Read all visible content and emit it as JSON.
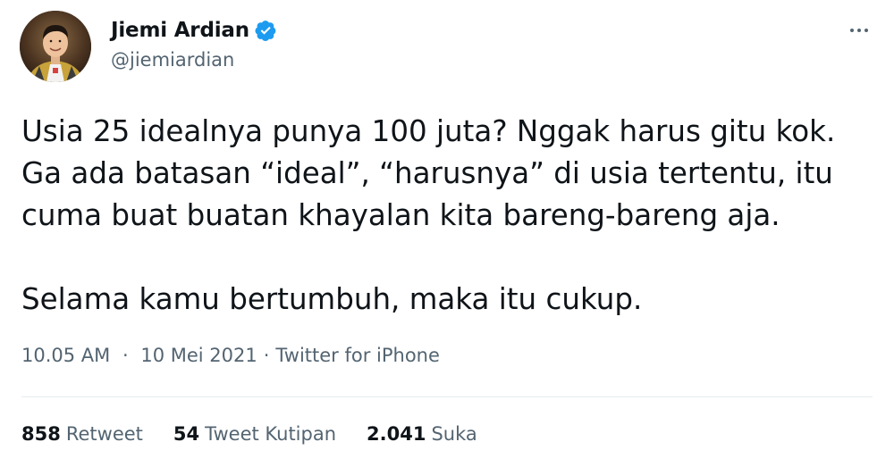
{
  "user": {
    "display_name": "Jiemi Ardian",
    "handle": "@jiemiardian",
    "verified": true,
    "verified_color": "#1d9bf0"
  },
  "tweet": {
    "text": "Usia 25 idealnya punya 100 juta? Nggak harus gitu kok.\nGa ada batasan “ideal”, “harusnya” di usia tertentu, itu\ncuma buat buatan khayalan kita bareng-bareng aja.\n\nSelama kamu bertumbuh, maka itu cukup.",
    "time": "10.05 AM",
    "date": "10 Mei 2021",
    "source": "Twitter for iPhone",
    "separator": "·"
  },
  "stats": {
    "retweets": {
      "count": "858",
      "label": "Retweet"
    },
    "quotes": {
      "count": "54",
      "label": "Tweet Kutipan"
    },
    "likes": {
      "count": "2.041",
      "label": "Suka"
    }
  },
  "icons": {
    "more": "more-horizontal-icon",
    "verified": "verified-badge-icon"
  }
}
